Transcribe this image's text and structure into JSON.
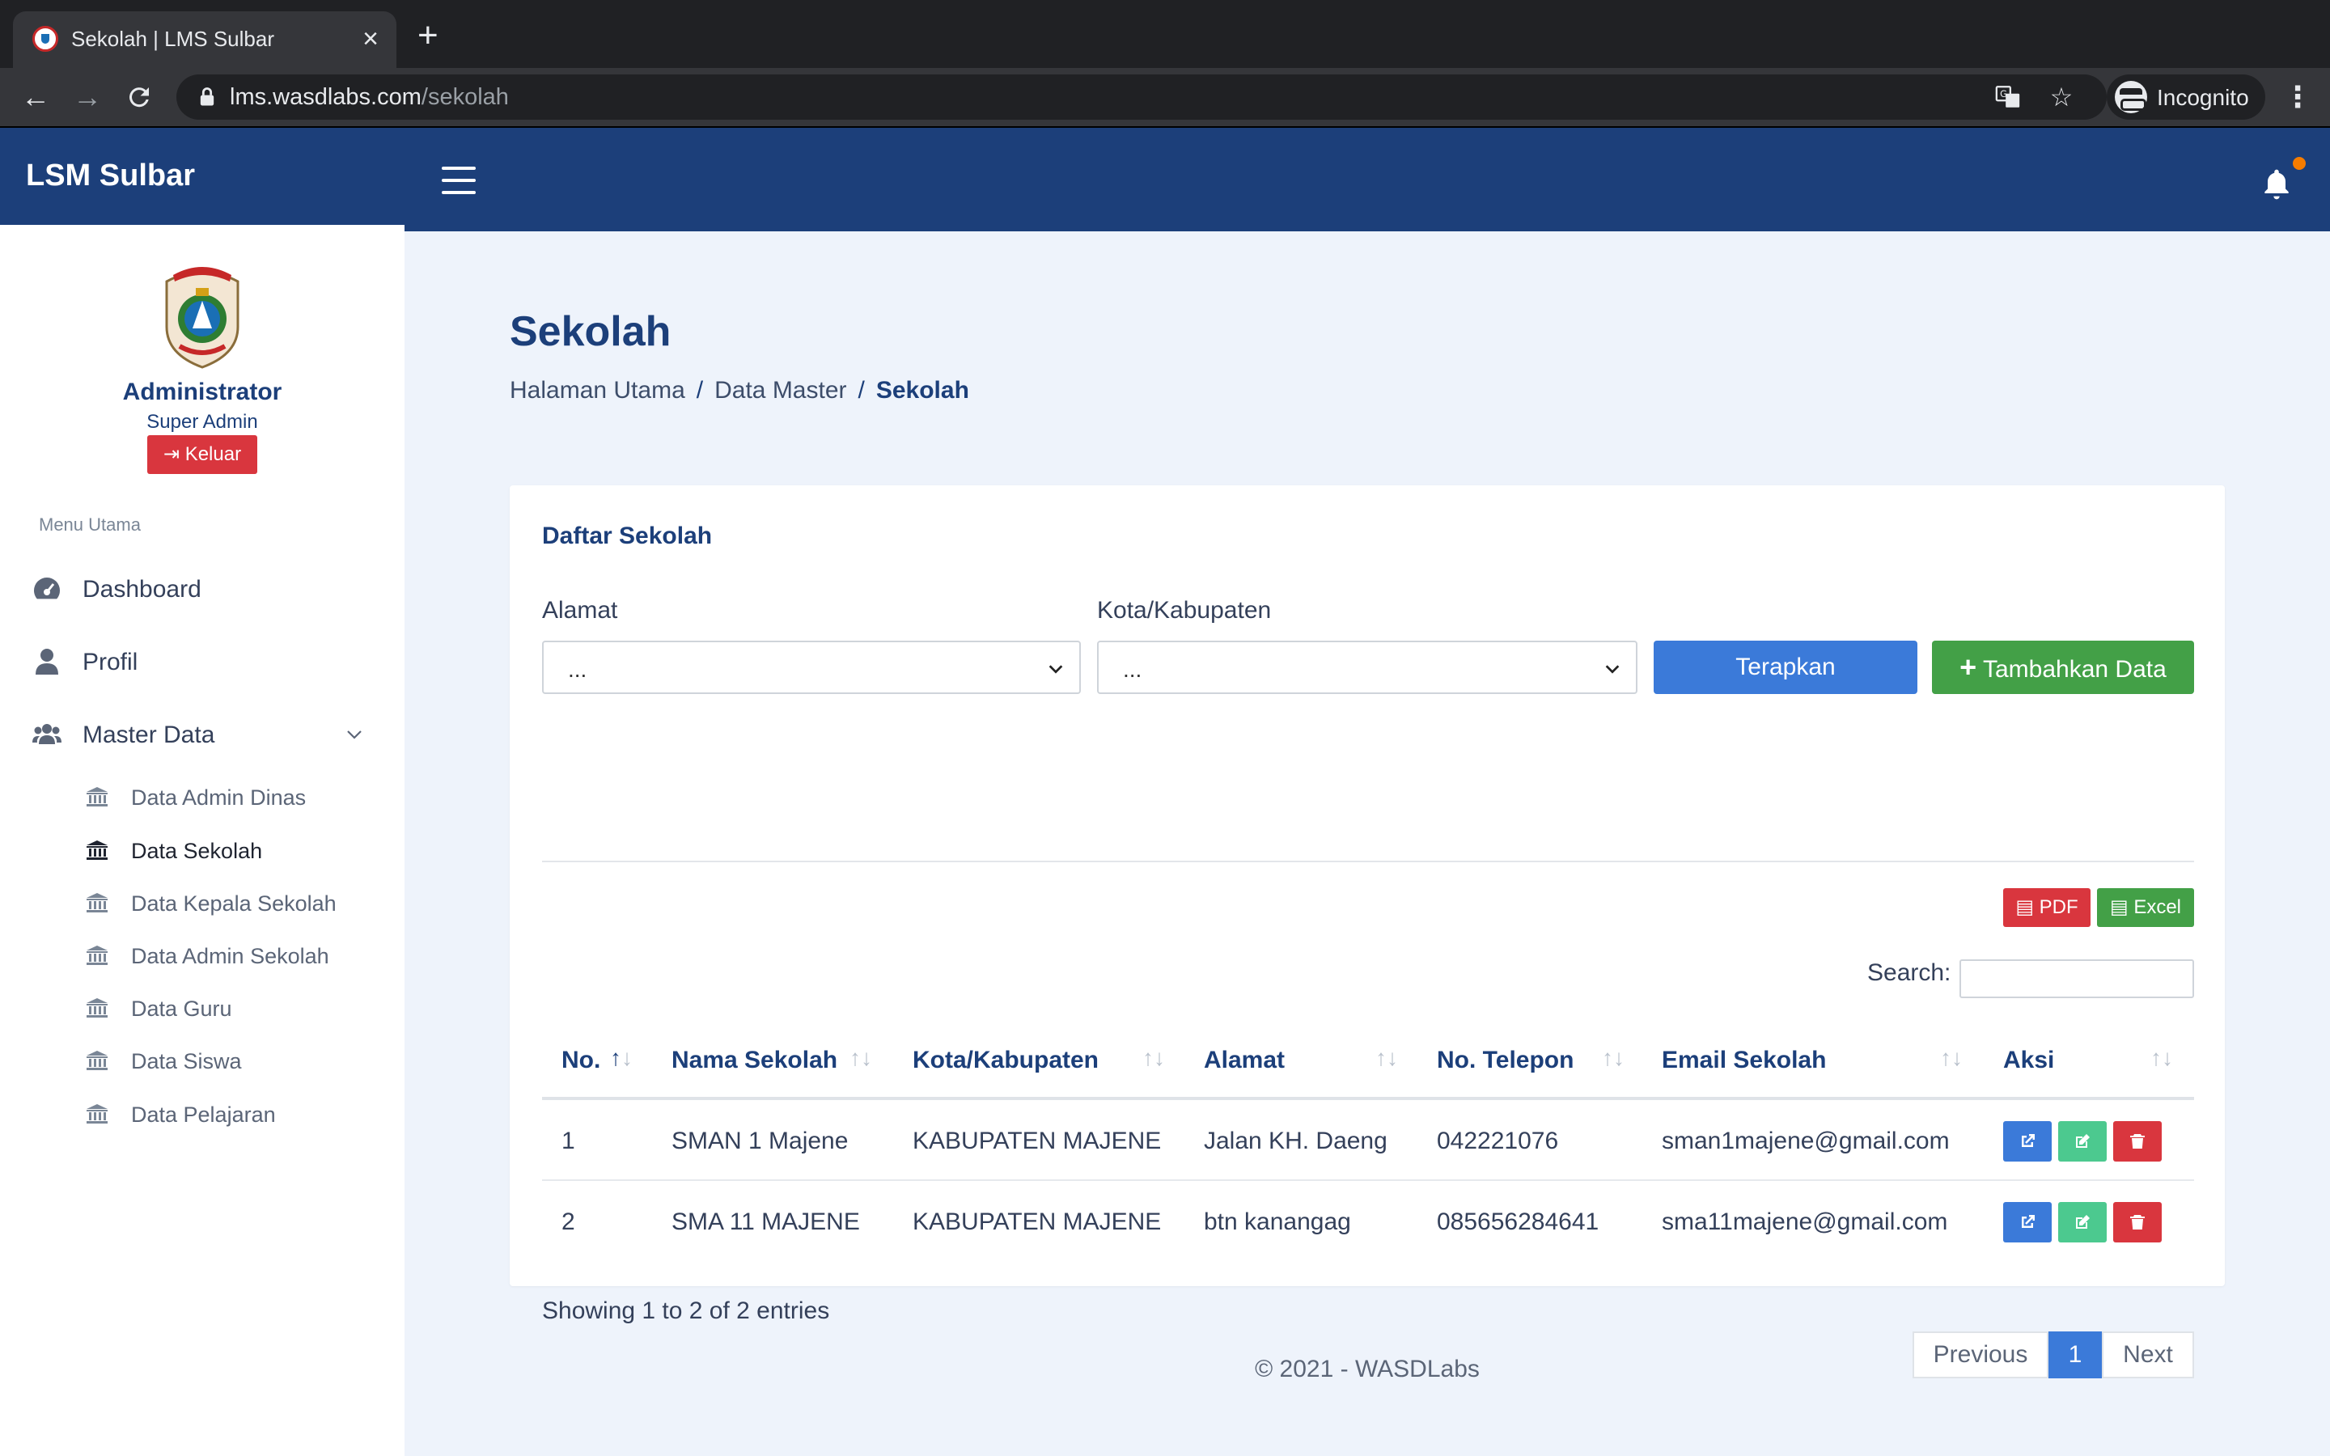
{
  "browser": {
    "tab_title": "Sekolah | LMS Sulbar",
    "url_host": "lms.wasdlabs.com",
    "url_path": "/sekolah",
    "profile_label": "Incognito"
  },
  "app": {
    "brand": "LSM Sulbar"
  },
  "user": {
    "name": "Administrator",
    "role": "Super Admin",
    "logout_label": "Keluar"
  },
  "sidebar": {
    "heading": "Menu Utama",
    "items": [
      {
        "label": "Dashboard",
        "icon": "tachometer-icon"
      },
      {
        "label": "Profil",
        "icon": "user-icon"
      },
      {
        "label": "Master Data",
        "icon": "users-icon"
      }
    ],
    "sub_items": [
      {
        "label": "Data Admin Dinas"
      },
      {
        "label": "Data Sekolah",
        "active": true
      },
      {
        "label": "Data Kepala Sekolah"
      },
      {
        "label": "Data Admin Sekolah"
      },
      {
        "label": "Data Guru"
      },
      {
        "label": "Data Siswa"
      },
      {
        "label": "Data Pelajaran"
      }
    ]
  },
  "page": {
    "title": "Sekolah",
    "breadcrumb": [
      "Halaman Utama",
      "Data Master",
      "Sekolah"
    ]
  },
  "card": {
    "title": "Daftar Sekolah",
    "filters": {
      "alamat_label": "Alamat",
      "alamat_value": "...",
      "kota_label": "Kota/Kabupaten",
      "kota_value": "..."
    },
    "apply_label": "Terapkan",
    "add_label": "Tambahkan Data",
    "export_pdf": "PDF",
    "export_excel": "Excel",
    "search_label": "Search:",
    "search_value": ""
  },
  "table": {
    "columns": [
      "No.",
      "Nama Sekolah",
      "Kota/Kabupaten",
      "Alamat",
      "No. Telepon",
      "Email Sekolah",
      "Aksi"
    ],
    "rows": [
      {
        "no": "1",
        "nama": "SMAN 1 Majene",
        "kota": "KABUPATEN MAJENE",
        "alamat": "Jalan KH. Daeng",
        "telepon": "042221076",
        "email": "sman1majene@gmail.com"
      },
      {
        "no": "2",
        "nama": "SMA 11 MAJENE",
        "kota": "KABUPATEN MAJENE",
        "alamat": "btn kanangag",
        "telepon": "085656284641",
        "email": "sma11majene@gmail.com"
      }
    ],
    "info": "Showing 1 to 2 of 2 entries",
    "pagination": {
      "previous": "Previous",
      "current": "1",
      "next": "Next"
    }
  },
  "footer": {
    "text": "© 2021 - WASDLabs"
  },
  "colors": {
    "primary": "#1c3f7a",
    "apply": "#3b7ad9",
    "success": "#43a047",
    "danger": "#d9363e",
    "edit": "#4cc98f",
    "notification": "#f57c00"
  }
}
